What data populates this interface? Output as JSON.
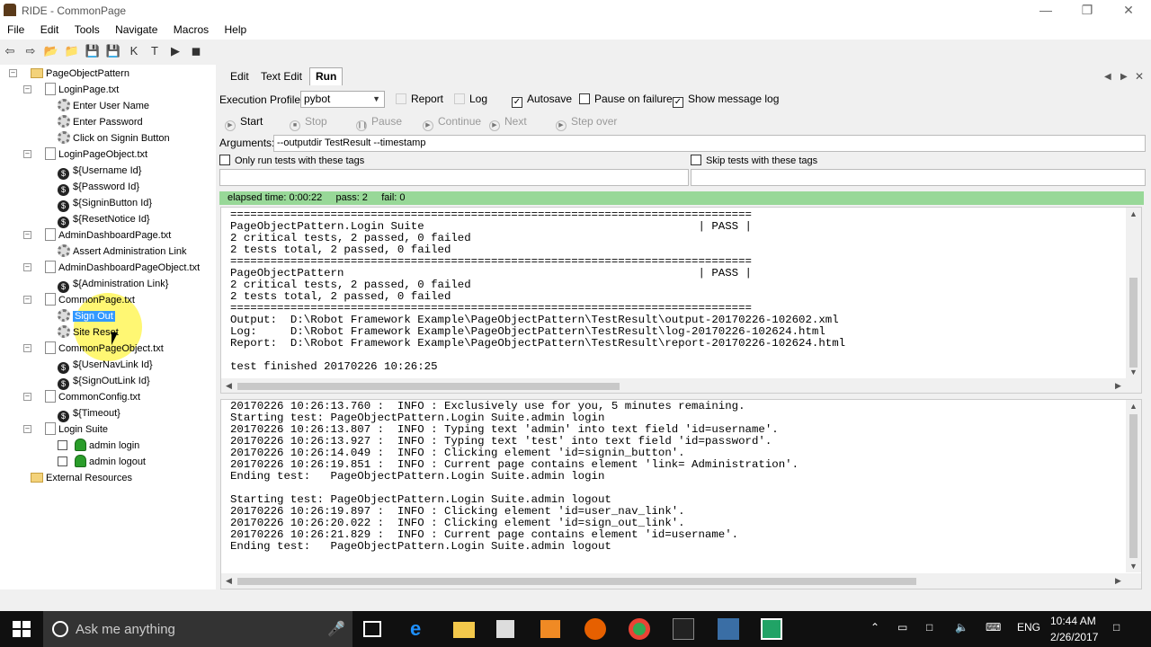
{
  "window": {
    "title": "RIDE - CommonPage"
  },
  "menu": [
    "File",
    "Edit",
    "Tools",
    "Navigate",
    "Macros",
    "Help"
  ],
  "tree": [
    {
      "label": "PageObjectPattern",
      "type": "folder"
    },
    {
      "label": "LoginPage.txt",
      "type": "file"
    },
    {
      "label": "Enter User Name",
      "type": "keyword"
    },
    {
      "label": "Enter Password",
      "type": "keyword"
    },
    {
      "label": "Click on Signin Button",
      "type": "keyword"
    },
    {
      "label": "LoginPageObject.txt",
      "type": "file"
    },
    {
      "label": "${Username Id}",
      "type": "variable"
    },
    {
      "label": "${Password Id}",
      "type": "variable"
    },
    {
      "label": "${SigninButton Id}",
      "type": "variable"
    },
    {
      "label": "${ResetNotice Id}",
      "type": "variable"
    },
    {
      "label": "AdminDashboardPage.txt",
      "type": "file"
    },
    {
      "label": "Assert Administration Link",
      "type": "keyword"
    },
    {
      "label": "AdminDashboardPageObject.txt",
      "type": "file"
    },
    {
      "label": "${Administration Link}",
      "type": "variable"
    },
    {
      "label": "CommonPage.txt",
      "type": "file"
    },
    {
      "label": "Sign Out",
      "type": "keyword"
    },
    {
      "label": "Site Reset",
      "type": "keyword"
    },
    {
      "label": "CommonPageObject.txt",
      "type": "file"
    },
    {
      "label": "${UserNavLink Id}",
      "type": "variable"
    },
    {
      "label": "${SignOutLink Id}",
      "type": "variable"
    },
    {
      "label": "CommonConfig.txt",
      "type": "file"
    },
    {
      "label": "${Timeout}",
      "type": "variable"
    },
    {
      "label": "Login Suite",
      "type": "file"
    },
    {
      "label": "admin login",
      "type": "test"
    },
    {
      "label": "admin logout",
      "type": "test"
    },
    {
      "label": "External Resources",
      "type": "folder"
    }
  ],
  "tabs": {
    "edit": "Edit",
    "text_edit": "Text Edit",
    "run": "Run"
  },
  "run": {
    "profile_label": "Execution Profile:",
    "profile_value": "pybot",
    "report": "Report",
    "log": "Log",
    "autosave": "Autosave",
    "pause_on_failure": "Pause on failure",
    "show_message_log": "Show message log",
    "start": "Start",
    "stop": "Stop",
    "pause": "Pause",
    "continue": "Continue",
    "next": "Next",
    "step_over": "Step over",
    "arguments_label": "Arguments:",
    "arguments_value": "--outputdir TestResult --timestamp",
    "only_run_tags": "Only run tests with these tags",
    "skip_tags": "Skip tests with these tags",
    "status": "elapsed time: 0:00:22     pass: 2     fail: 0"
  },
  "output_text": "==============================================================================\nPageObjectPattern.Login Suite                                         | PASS |\n2 critical tests, 2 passed, 0 failed\n2 tests total, 2 passed, 0 failed\n==============================================================================\nPageObjectPattern                                                     | PASS |\n2 critical tests, 2 passed, 0 failed\n2 tests total, 2 passed, 0 failed\n==============================================================================\nOutput:  D:\\Robot Framework Example\\PageObjectPattern\\TestResult\\output-20170226-102602.xml\nLog:     D:\\Robot Framework Example\\PageObjectPattern\\TestResult\\log-20170226-102624.html\nReport:  D:\\Robot Framework Example\\PageObjectPattern\\TestResult\\report-20170226-102624.html\n\ntest finished 20170226 10:26:25",
  "log_text": "20170226 10:26:13.760 :  INFO : Exclusively use for you, 5 minutes remaining.\nStarting test: PageObjectPattern.Login Suite.admin login\n20170226 10:26:13.807 :  INFO : Typing text 'admin' into text field 'id=username'.\n20170226 10:26:13.927 :  INFO : Typing text 'test' into text field 'id=password'.\n20170226 10:26:14.049 :  INFO : Clicking element 'id=signin_button'.\n20170226 10:26:19.851 :  INFO : Current page contains element 'link= Administration'.\nEnding test:   PageObjectPattern.Login Suite.admin login\n\nStarting test: PageObjectPattern.Login Suite.admin logout\n20170226 10:26:19.897 :  INFO : Clicking element 'id=user_nav_link'.\n20170226 10:26:20.022 :  INFO : Clicking element 'id=sign_out_link'.\n20170226 10:26:21.829 :  INFO : Current page contains element 'id=username'.\nEnding test:   PageObjectPattern.Login Suite.admin logout",
  "taskbar": {
    "search_placeholder": "Ask me anything",
    "lang": "ENG",
    "time": "10:44 AM",
    "date": "2/26/2017"
  }
}
